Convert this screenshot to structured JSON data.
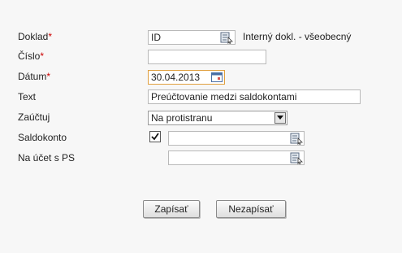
{
  "form": {
    "doklad": {
      "label": "Doklad",
      "required_mark": "*",
      "value": "ID",
      "description": "Interný dokl. - všeobecný"
    },
    "cislo": {
      "label": "Číslo",
      "required_mark": "*",
      "value": ""
    },
    "datum": {
      "label": "Dátum",
      "required_mark": "*",
      "value": "30.04.2013"
    },
    "text": {
      "label": "Text",
      "value": "Preúčtovanie medzi saldokontami"
    },
    "zauctuj": {
      "label": "Zaúčtuj",
      "selected": "Na protistranu"
    },
    "saldokonto": {
      "label": "Saldokonto",
      "checked": true,
      "value": ""
    },
    "na_ucet_ps": {
      "label": "Na účet s PS",
      "value": ""
    }
  },
  "buttons": {
    "save_label": "Zapísať",
    "cancel_label": "Nezapísať"
  },
  "icons": {
    "lookup": "lookup-icon",
    "calendar": "calendar-icon",
    "dropdown": "dropdown-arrow-icon",
    "check": "checkmark-icon"
  },
  "colors": {
    "required": "#cc0000",
    "background": "#f7f7f7"
  }
}
